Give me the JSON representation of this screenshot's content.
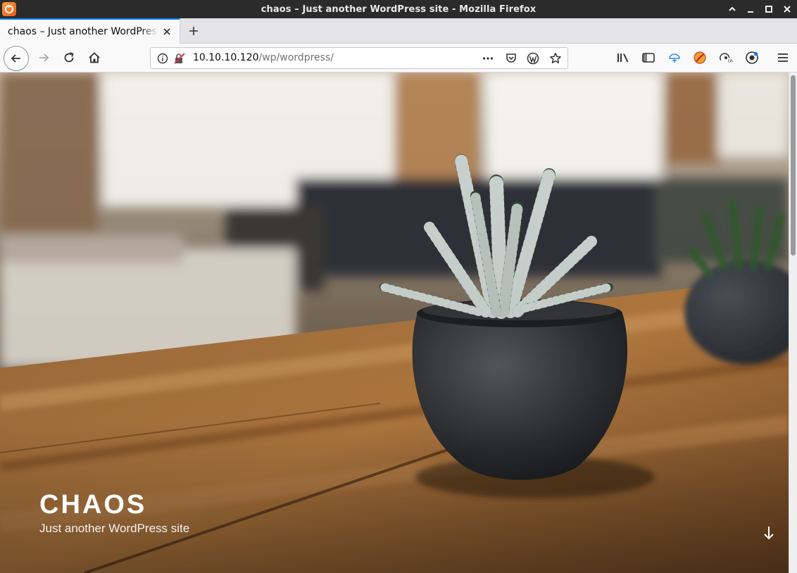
{
  "window": {
    "title": "chaos – Just another WordPress site - Mozilla Firefox",
    "controls": [
      "^",
      "_",
      "□",
      "×"
    ]
  },
  "tabs": [
    {
      "title": "chaos – Just another WordPress site",
      "active": true
    }
  ],
  "toolbar": {
    "url_host": "10.10.10.120",
    "url_path": "/wp/wordpress/",
    "icons": [
      "back-icon",
      "forward-icon",
      "reload-icon",
      "home-icon",
      "info-icon",
      "insecure-lock-icon",
      "page-actions-icon",
      "pocket-icon",
      "wordpress-icon",
      "bookmark-star-icon",
      "library-icon",
      "sidebar-icon",
      "extension-icon",
      "extension-icon",
      "extension-icon",
      "extension-icon",
      "menu-icon"
    ]
  },
  "site": {
    "title": "CHAOS",
    "description": "Just another WordPress site"
  },
  "colors": {
    "titlebar": "#2b2b2b",
    "tab_accent": "#0a84ff",
    "toolbar": "#f9f9fa"
  }
}
